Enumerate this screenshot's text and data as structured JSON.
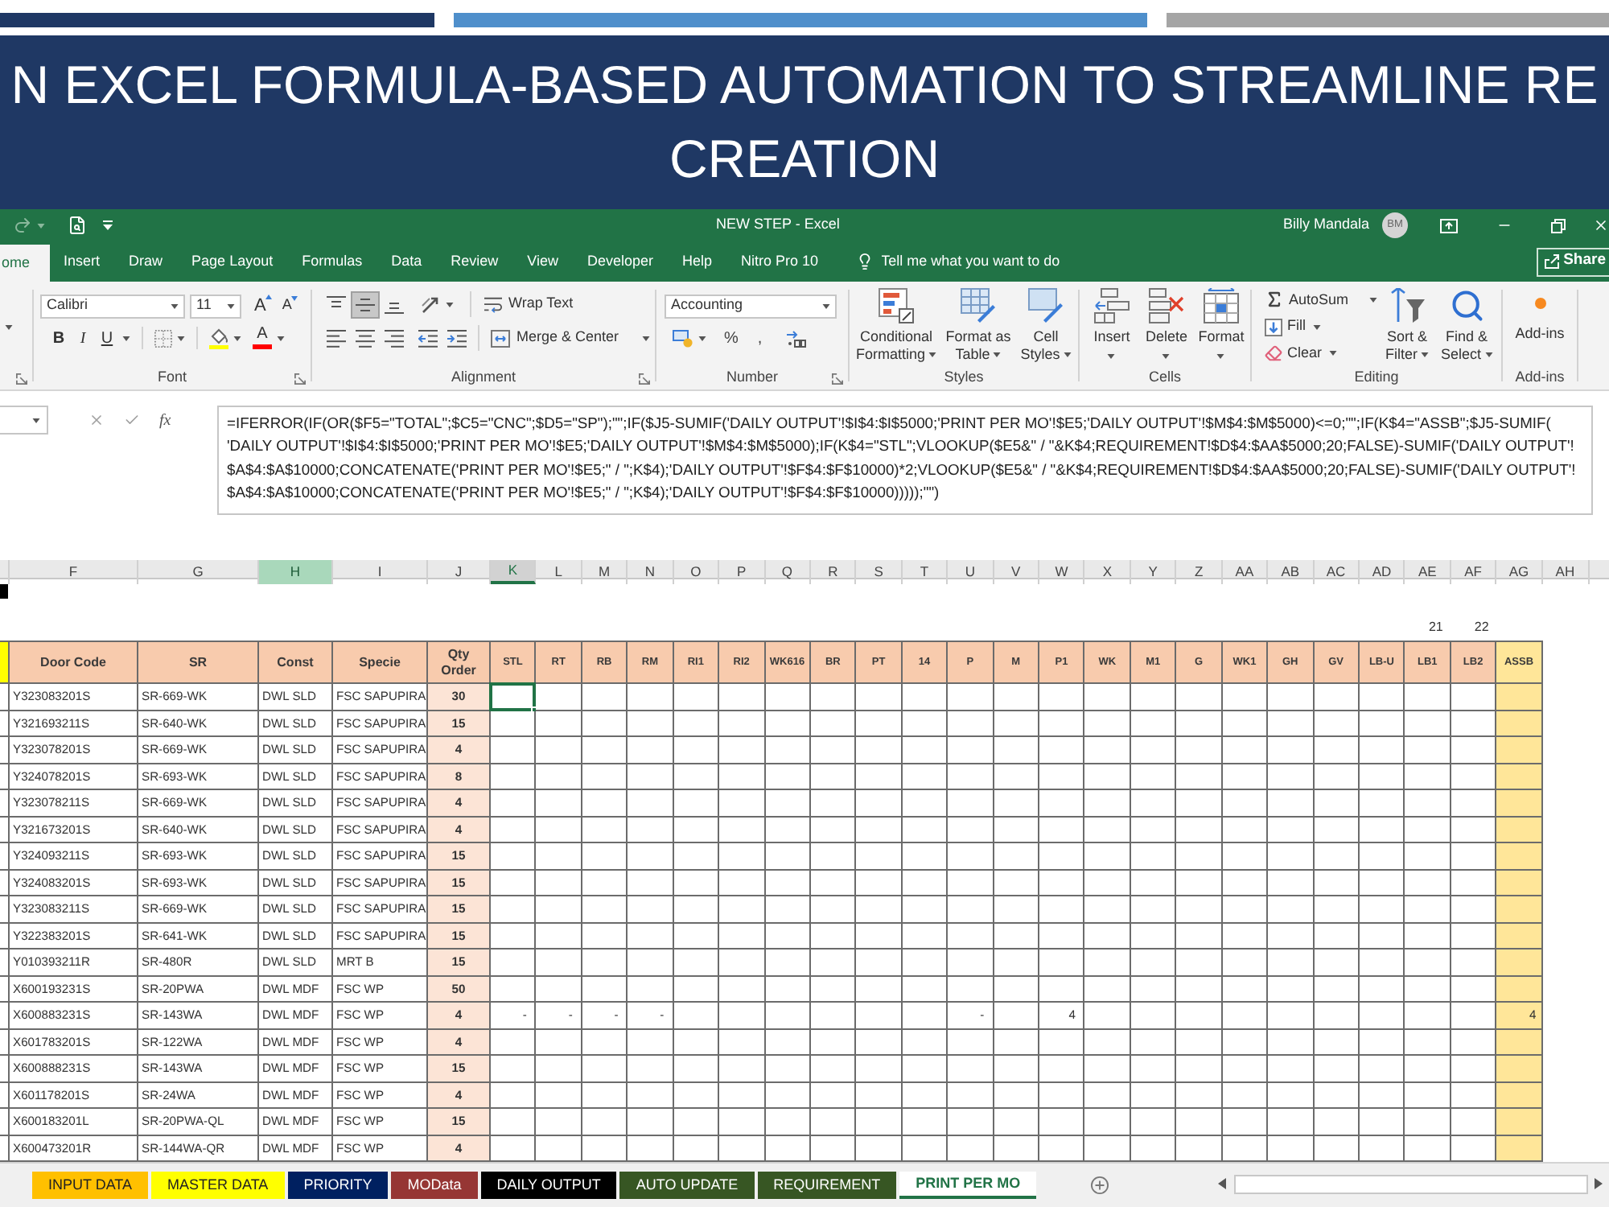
{
  "slide": {
    "title_lines": [
      "N EXCEL FORMULA-BASED AUTOMATION TO STREAMLINE RE",
      "CREATION"
    ]
  },
  "window": {
    "title": "NEW STEP - Excel",
    "user": "Billy Mandala",
    "avatar_initials": "BM"
  },
  "ribbon_tabs": [
    {
      "label": "ome",
      "selected": true
    },
    {
      "label": "Insert",
      "selected": false
    },
    {
      "label": "Draw",
      "selected": false
    },
    {
      "label": "Page Layout",
      "selected": false
    },
    {
      "label": "Formulas",
      "selected": false
    },
    {
      "label": "Data",
      "selected": false
    },
    {
      "label": "Review",
      "selected": false
    },
    {
      "label": "View",
      "selected": false
    },
    {
      "label": "Developer",
      "selected": false
    },
    {
      "label": "Help",
      "selected": false
    },
    {
      "label": "Nitro Pro 10",
      "selected": false
    }
  ],
  "tell_me": {
    "placeholder": "Tell me what you want to do"
  },
  "share_button": {
    "label": "Share"
  },
  "ribbon_groups": [
    {
      "kind": "font",
      "label": "Font",
      "font_name": "Calibri",
      "font_size": "11",
      "size_glyphs": [
        "A",
        "A"
      ],
      "styles": [
        "B",
        "I",
        "U"
      ],
      "font_color_glyph": "A"
    },
    {
      "kind": "alignment",
      "label": "Alignment",
      "vertical_align": [
        {
          "kind": "top",
          "selected": false
        },
        {
          "kind": "middle",
          "selected": true
        },
        {
          "kind": "bottom",
          "selected": false
        }
      ],
      "wrap_text": "Wrap Text",
      "merge": "Merge & Center"
    },
    {
      "kind": "number",
      "label": "Number",
      "format": "Accounting",
      "symbols": [
        "%",
        ","
      ]
    },
    {
      "kind": "styles",
      "label": "Styles",
      "buttons": [
        {
          "kind": "conditional",
          "lines": [
            "Conditional",
            "Formatting"
          ]
        },
        {
          "kind": "table",
          "lines": [
            "Format as",
            "Table"
          ]
        },
        {
          "kind": "cell",
          "lines": [
            "Cell",
            "Styles"
          ]
        }
      ]
    },
    {
      "kind": "cells",
      "label": "Cells",
      "buttons": [
        {
          "kind": "insert",
          "label": "Insert"
        },
        {
          "kind": "delete",
          "label": "Delete"
        },
        {
          "kind": "format",
          "label": "Format"
        }
      ]
    },
    {
      "kind": "editing",
      "label": "Editing",
      "rows": [
        {
          "kind": "autosum",
          "label": "AutoSum"
        },
        {
          "kind": "fill",
          "label": "Fill"
        },
        {
          "kind": "clear",
          "label": "Clear"
        }
      ],
      "buttons": [
        {
          "kind": "sort",
          "lines": [
            "Sort &",
            "Filter"
          ]
        },
        {
          "kind": "find",
          "lines": [
            "Find &",
            "Select"
          ]
        }
      ]
    },
    {
      "kind": "addins",
      "label": "Add-ins",
      "button": "Add-ins"
    }
  ],
  "formula_bar": {
    "function_button": "fx",
    "formula_lines": [
      "=IFERROR(IF(OR($F5=\"TOTAL\";$C5=\"CNC\";$D5=\"SP\");\"\";IF($J5-SUMIF('DAILY OUTPUT'!$I$4:$I$5000;'PRINT PER MO'!$E5;'DAILY OUTPUT'!$M$4:$M$5000)<=0;\"\";IF(K$4=\"ASSB\";$J5-SUMIF(",
      "'DAILY OUTPUT'!$I$4:$I$5000;'PRINT PER MO'!$E5;'DAILY OUTPUT'!$M$4:$M$5000);IF(K$4=\"STL\";VLOOKUP($E5&\" / \"&K$4;REQUIREMENT!$D$4:$AA$5000;20;FALSE)-SUMIF('DAILY OUTPUT'!",
      "$A$4:$A$10000;CONCATENATE('PRINT PER MO'!$E5;\" / \";K$4);'DAILY OUTPUT'!$F$4:$F$10000)*2;VLOOKUP($E5&\" / \"&K$4;REQUIREMENT!$D$4:$AA$5000;20;FALSE)-SUMIF('DAILY OUTPUT'!",
      "$A$4:$A$10000;CONCATENATE('PRINT PER MO'!$E5;\" / \";K$4);'DAILY OUTPUT'!$F$4:$F$10000)))));\"\")"
    ]
  },
  "sheet": {
    "column_letters": [
      {
        "label": "F",
        "selected": false,
        "highlighted": false
      },
      {
        "label": "G",
        "selected": false,
        "highlighted": false
      },
      {
        "label": "H",
        "selected": false,
        "highlighted": true
      },
      {
        "label": "I",
        "selected": false,
        "highlighted": false
      },
      {
        "label": "J",
        "selected": false,
        "highlighted": false
      },
      {
        "label": "K",
        "selected": true,
        "highlighted": false
      },
      {
        "label": "L",
        "selected": false,
        "highlighted": false
      },
      {
        "label": "M",
        "selected": false,
        "highlighted": false
      },
      {
        "label": "N",
        "selected": false,
        "highlighted": false
      },
      {
        "label": "O",
        "selected": false,
        "highlighted": false
      },
      {
        "label": "P",
        "selected": false,
        "highlighted": false
      },
      {
        "label": "Q",
        "selected": false,
        "highlighted": false
      },
      {
        "label": "R",
        "selected": false,
        "highlighted": false
      },
      {
        "label": "S",
        "selected": false,
        "highlighted": false
      },
      {
        "label": "T",
        "selected": false,
        "highlighted": false
      },
      {
        "label": "U",
        "selected": false,
        "highlighted": false
      },
      {
        "label": "V",
        "selected": false,
        "highlighted": false
      },
      {
        "label": "W",
        "selected": false,
        "highlighted": false
      },
      {
        "label": "X",
        "selected": false,
        "highlighted": false
      },
      {
        "label": "Y",
        "selected": false,
        "highlighted": false
      },
      {
        "label": "Z",
        "selected": false,
        "highlighted": false
      },
      {
        "label": "AA",
        "selected": false,
        "highlighted": false
      },
      {
        "label": "AB",
        "selected": false,
        "highlighted": false
      },
      {
        "label": "AC",
        "selected": false,
        "highlighted": false
      },
      {
        "label": "AD",
        "selected": false,
        "highlighted": false
      },
      {
        "label": "AE",
        "selected": false,
        "highlighted": false
      },
      {
        "label": "AF",
        "selected": false,
        "highlighted": false
      },
      {
        "label": "AG",
        "selected": false,
        "highlighted": false
      },
      {
        "label": "AH",
        "selected": false,
        "highlighted": false
      }
    ],
    "columns": [
      {
        "label": "Door Code",
        "kind": "text"
      },
      {
        "label": "SR",
        "kind": "text"
      },
      {
        "label": "Const",
        "kind": "text"
      },
      {
        "label": "Specie",
        "kind": "text"
      },
      {
        "label": "Qty Order",
        "kind": "qty"
      },
      {
        "label": "STL",
        "kind": "count"
      },
      {
        "label": "RT",
        "kind": "count"
      },
      {
        "label": "RB",
        "kind": "count"
      },
      {
        "label": "RM",
        "kind": "count"
      },
      {
        "label": "RI1",
        "kind": "count"
      },
      {
        "label": "RI2",
        "kind": "count"
      },
      {
        "label": "WK616",
        "kind": "count"
      },
      {
        "label": "BR",
        "kind": "count"
      },
      {
        "label": "PT",
        "kind": "count"
      },
      {
        "label": "14",
        "kind": "count"
      },
      {
        "label": "P",
        "kind": "count"
      },
      {
        "label": "M",
        "kind": "count"
      },
      {
        "label": "P1",
        "kind": "count"
      },
      {
        "label": "WK",
        "kind": "count"
      },
      {
        "label": "M1",
        "kind": "count"
      },
      {
        "label": "G",
        "kind": "count"
      },
      {
        "label": "WK1",
        "kind": "count"
      },
      {
        "label": "GH",
        "kind": "count"
      },
      {
        "label": "GV",
        "kind": "count"
      },
      {
        "label": "LB-U",
        "kind": "count"
      },
      {
        "label": "LB1",
        "kind": "count",
        "note": "21"
      },
      {
        "label": "LB2",
        "kind": "count",
        "note": "22"
      },
      {
        "label": "ASSB",
        "kind": "total"
      }
    ],
    "rows": [
      {
        "active": true,
        "cells": [
          "Y323083201S",
          "SR-669-WK",
          "DWL SLD",
          "FSC SAPUPIRA",
          "30"
        ]
      },
      {
        "active": false,
        "cells": [
          "Y321693211S",
          "SR-640-WK",
          "DWL SLD",
          "FSC SAPUPIRA",
          "15"
        ]
      },
      {
        "active": false,
        "cells": [
          "Y323078201S",
          "SR-669-WK",
          "DWL SLD",
          "FSC SAPUPIRA",
          "4"
        ]
      },
      {
        "active": false,
        "cells": [
          "Y324078201S",
          "SR-693-WK",
          "DWL SLD",
          "FSC SAPUPIRA",
          "8"
        ]
      },
      {
        "active": false,
        "cells": [
          "Y323078211S",
          "SR-669-WK",
          "DWL SLD",
          "FSC SAPUPIRA",
          "4"
        ]
      },
      {
        "active": false,
        "cells": [
          "Y321673201S",
          "SR-640-WK",
          "DWL SLD",
          "FSC SAPUPIRA",
          "4"
        ]
      },
      {
        "active": false,
        "cells": [
          "Y324093211S",
          "SR-693-WK",
          "DWL SLD",
          "FSC SAPUPIRA",
          "15"
        ]
      },
      {
        "active": false,
        "cells": [
          "Y324083201S",
          "SR-693-WK",
          "DWL SLD",
          "FSC SAPUPIRA",
          "15"
        ]
      },
      {
        "active": false,
        "cells": [
          "Y323083211S",
          "SR-669-WK",
          "DWL SLD",
          "FSC SAPUPIRA",
          "15"
        ]
      },
      {
        "active": false,
        "cells": [
          "Y322383201S",
          "SR-641-WK",
          "DWL SLD",
          "FSC SAPUPIRA",
          "15"
        ]
      },
      {
        "active": false,
        "cells": [
          "Y010393211R",
          "SR-480R",
          "DWL SLD",
          "MRT B",
          "15"
        ]
      },
      {
        "active": false,
        "cells": [
          "X600193231S",
          "SR-20PWA",
          "DWL MDF",
          "FSC WP",
          "50"
        ]
      },
      {
        "active": false,
        "cells": [
          "X600883231S",
          "SR-143WA",
          "DWL MDF",
          "FSC WP",
          "4",
          "-",
          "-",
          "-",
          "-",
          null,
          null,
          null,
          null,
          null,
          null,
          "-",
          null,
          "4",
          null,
          null,
          null,
          null,
          null,
          null,
          null,
          null,
          null,
          "4"
        ]
      },
      {
        "active": false,
        "cells": [
          "X601783201S",
          "SR-122WA",
          "DWL MDF",
          "FSC WP",
          "4"
        ]
      },
      {
        "active": false,
        "cells": [
          "X600888231S",
          "SR-143WA",
          "DWL MDF",
          "FSC WP",
          "15"
        ]
      },
      {
        "active": false,
        "cells": [
          "X601178201S",
          "SR-24WA",
          "DWL MDF",
          "FSC WP",
          "4"
        ]
      },
      {
        "active": false,
        "cells": [
          "X600183201L",
          "SR-20PWA-QL",
          "DWL MDF",
          "FSC WP",
          "15"
        ]
      },
      {
        "active": false,
        "cells": [
          "X600473201R",
          "SR-144WA-QR",
          "DWL MDF",
          "FSC WP",
          "4"
        ]
      }
    ]
  },
  "sheet_tabs": [
    {
      "label": "INPUT DATA",
      "color": "#ffc000",
      "selected": false
    },
    {
      "label": "MASTER DATA",
      "color": "#ffff00",
      "selected": false
    },
    {
      "label": "PRIORITY",
      "color": "#002060",
      "selected": false
    },
    {
      "label": "MOData",
      "color": "#963634",
      "selected": false
    },
    {
      "label": "DAILY OUTPUT",
      "color": "#000000",
      "selected": false
    },
    {
      "label": "AUTO UPDATE",
      "color": "#375623",
      "selected": false
    },
    {
      "label": "REQUIREMENT",
      "color": "#375623",
      "selected": false
    },
    {
      "label": "PRINT PER MO",
      "color": "#217346",
      "selected": true
    }
  ]
}
